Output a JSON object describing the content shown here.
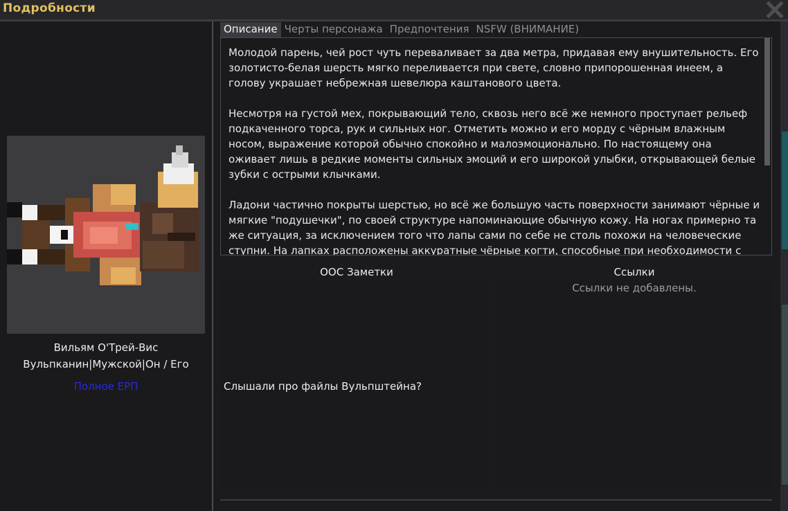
{
  "window": {
    "title": "Подробности",
    "close_icon": "close-icon"
  },
  "character": {
    "name": "Вильям О'Трей-Вис",
    "info": "Вульпканин|Мужской|Он / Его",
    "erp_link": "Полное ЕРП"
  },
  "tabs": [
    {
      "label": "Описание",
      "active": true
    },
    {
      "label": "Черты персонажа",
      "active": false
    },
    {
      "label": "Предпочтения",
      "active": false
    },
    {
      "label": "NSFW (ВНИМАНИЕ)",
      "active": false
    }
  ],
  "description": {
    "paragraphs": [
      "Молодой парень, чей рост чуть переваливает за два метра, придавая ему внушительность. Его золотисто-белая шерсть мягко переливается при свете, словно припорошенная инеем, а голову украшает небрежная шевелюра каштанового цвета.",
      "Несмотря на густой мех, покрывающий тело, сквозь него всё же немного проступает рельеф подкаченного торса, рук и сильных ног. Отметить можно и его морду с чёрным влажным носом, выражение которой обычно спокойно и малоэмоционально. По настоящему она оживает лишь в редкие моменты сильных эмоций и его широкой улыбки, открывающей белые зубки с острыми клычками.",
      "Ладони частично покрыты шерстью, но всё же большую часть поверхности занимают чёрные и мягкие \"подушечки\", по своей структуре напоминающие обычную кожу. На ногах примерно та же ситуация, за исключением того что лапы сами по себе не столь похожи на человеческие ступни. На лапках расположены аккуратные чёрные когти, способные при необходимости с"
    ]
  },
  "ooc": {
    "header": "ООС Заметки",
    "text": "Слышали про файлы Вульпштейна?"
  },
  "links": {
    "header": "Ссылки",
    "empty_text": "Ссылки не добавлены."
  },
  "colors": {
    "title_accent": "#e0c060",
    "link_color": "#2a2ad8",
    "background": "#1b1b1e"
  }
}
